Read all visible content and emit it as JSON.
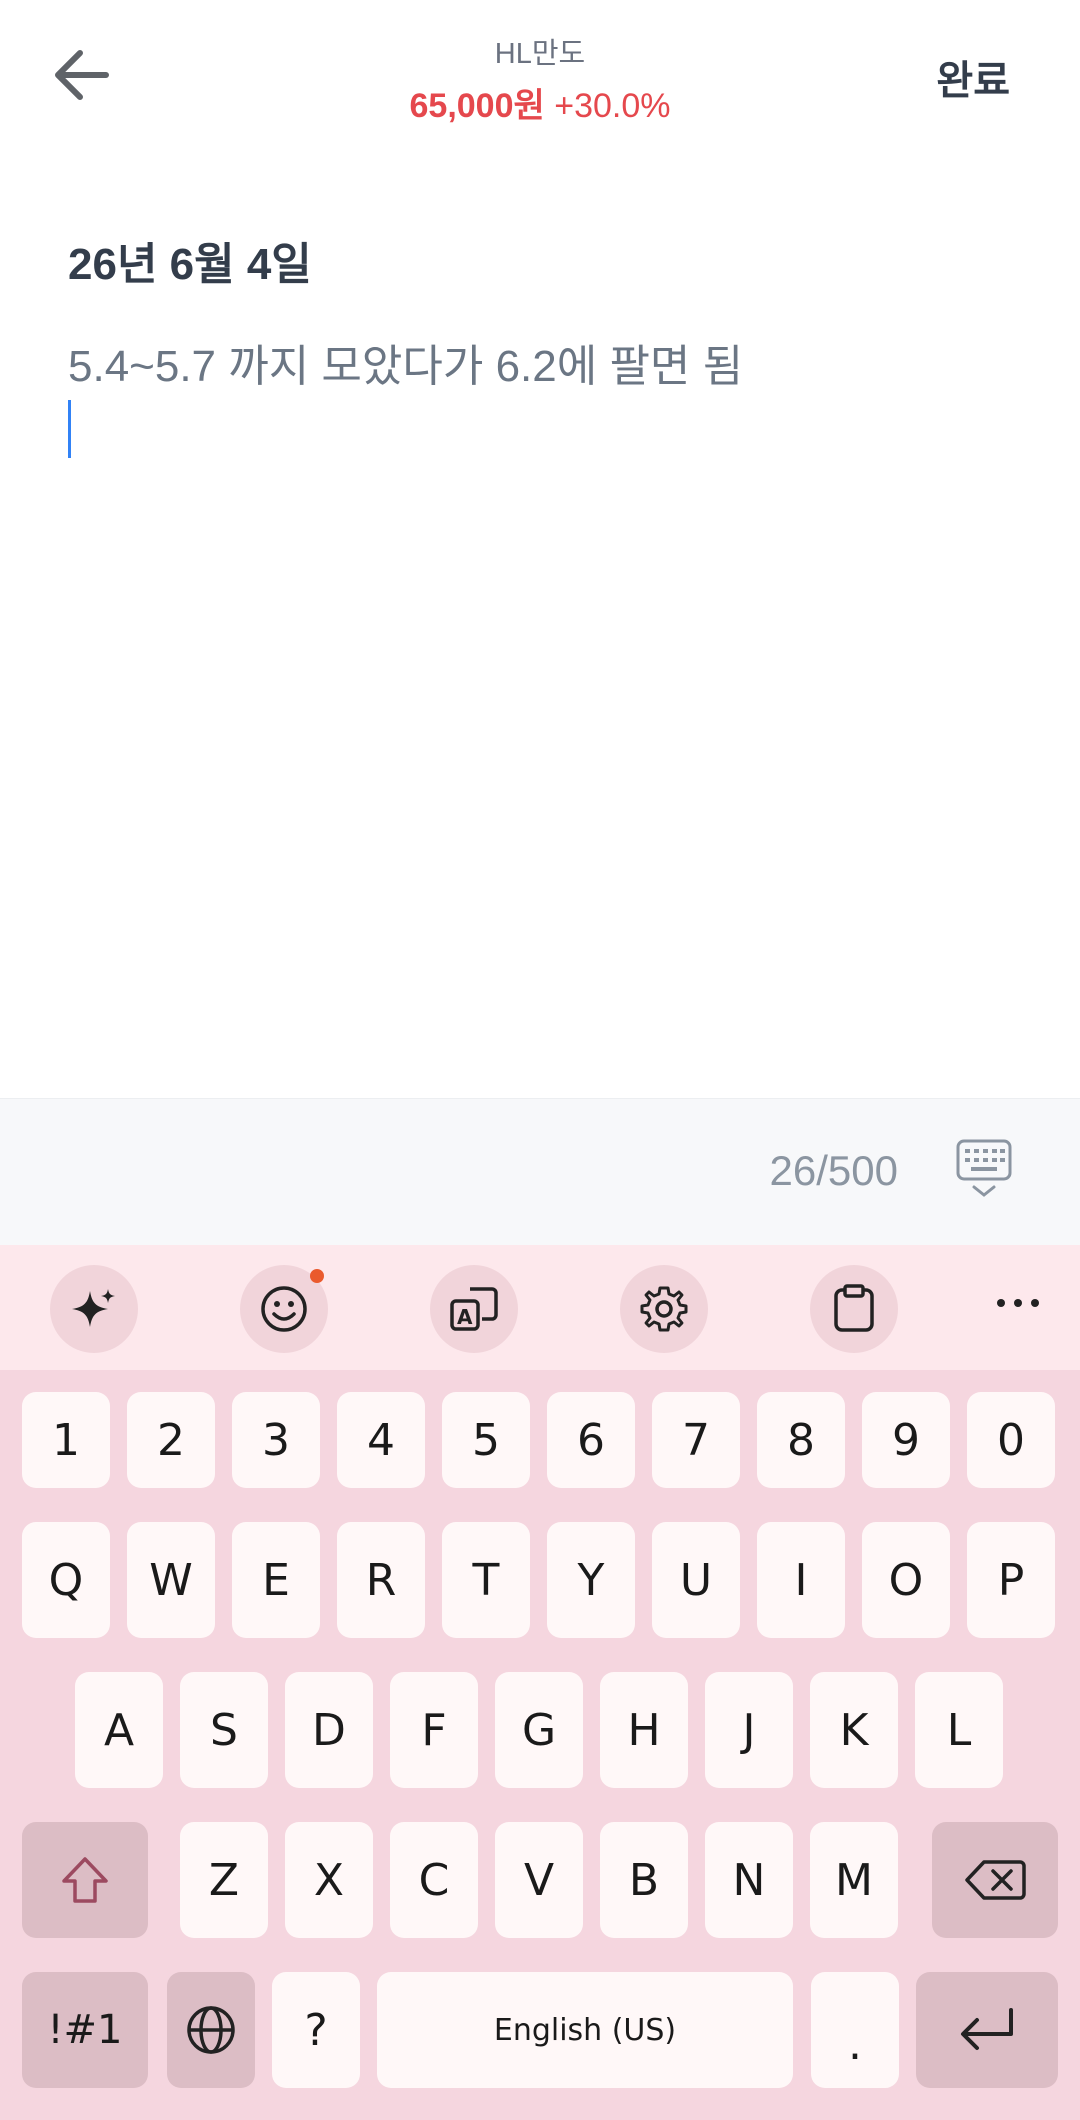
{
  "header": {
    "stock_name": "HL만도",
    "price": "65,000원",
    "change": "+30.0%",
    "done_label": "완료"
  },
  "memo": {
    "date": "26년 6월 4일",
    "text": "5.4~5.7 까지 모았다가 6.2에 팔면 됨"
  },
  "counter": "26/500",
  "keyboard": {
    "number_row": [
      "1",
      "2",
      "3",
      "4",
      "5",
      "6",
      "7",
      "8",
      "9",
      "0"
    ],
    "row1": [
      "Q",
      "W",
      "E",
      "R",
      "T",
      "Y",
      "U",
      "I",
      "O",
      "P"
    ],
    "row2": [
      "A",
      "S",
      "D",
      "F",
      "G",
      "H",
      "J",
      "K",
      "L"
    ],
    "row3": [
      "Z",
      "X",
      "C",
      "V",
      "B",
      "N",
      "M"
    ],
    "symbols_label": "!#1",
    "question_label": "?",
    "space_label": "English (US)",
    "period_label": "."
  },
  "colors": {
    "price_red": "#e5484d",
    "cursor_blue": "#3182f6",
    "keyboard_bg": "#f5d6df",
    "toolbar_bg": "#fde8ec"
  },
  "icons": {
    "back": "arrow-left-icon",
    "hide_keyboard": "keyboard-hide-icon",
    "toolbar": [
      "sparkle-icon",
      "emoji-icon",
      "translate-icon",
      "gear-icon",
      "clipboard-icon",
      "more-icon"
    ]
  }
}
